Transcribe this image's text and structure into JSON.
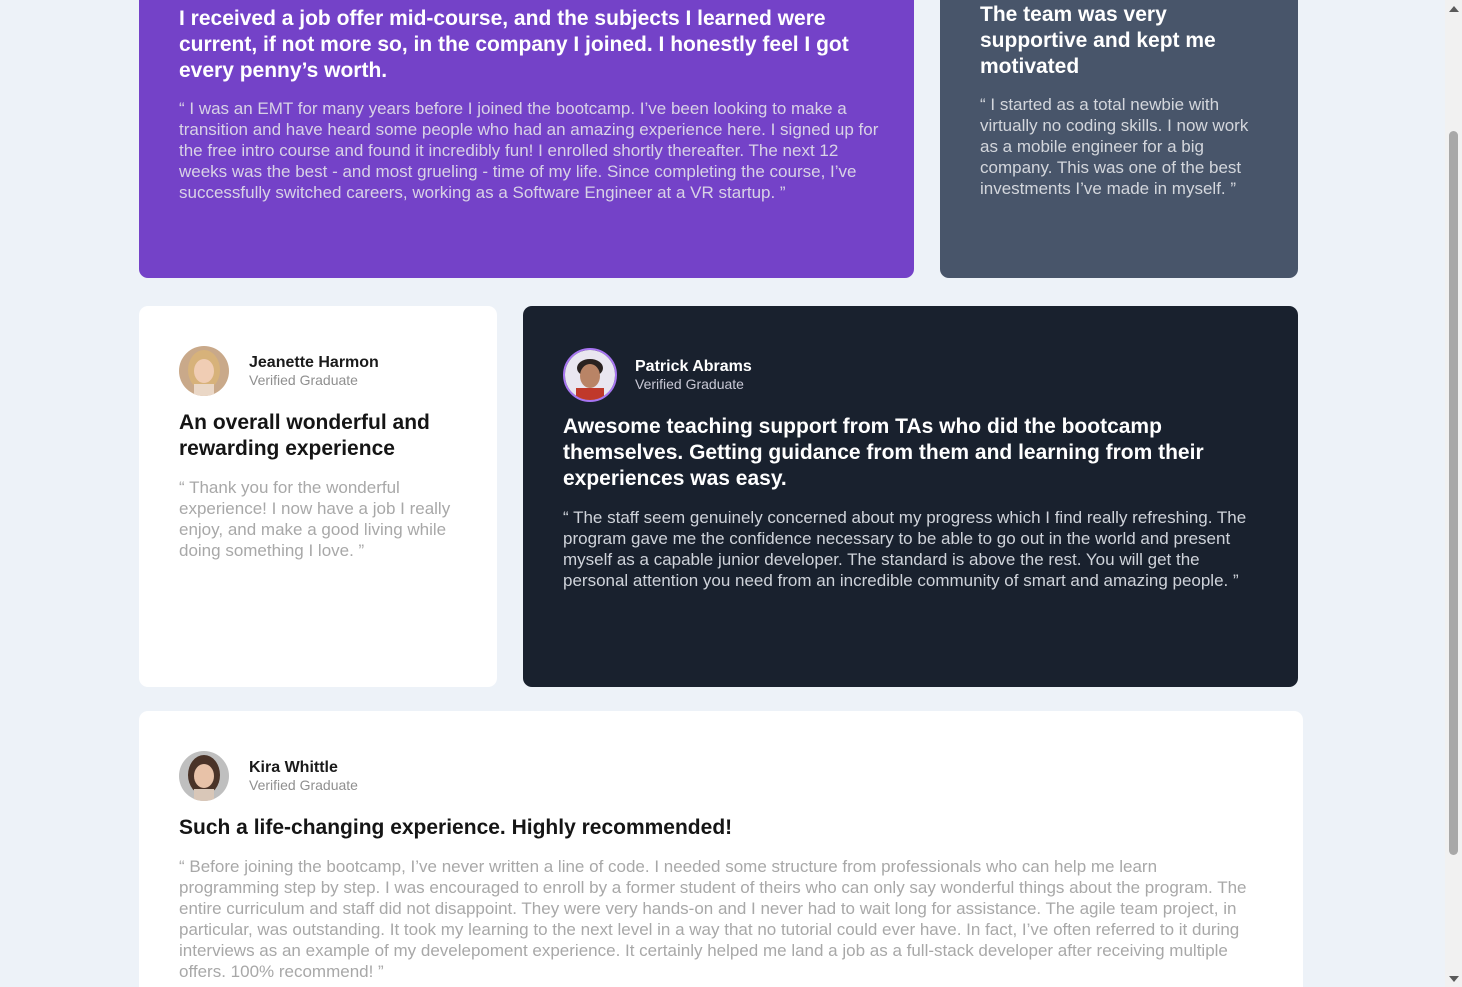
{
  "colors": {
    "page_background": "#edf2f8",
    "violet": "#7442c8",
    "grayish_blue": "#48556a",
    "very_dark_blue": "#19212e",
    "white": "#ffffff"
  },
  "testimonials": {
    "daniel": {
      "headline": "I received a job offer mid-course, and the subjects I learned were current, if not more so, in the company I joined. I honestly feel I got every penny’s worth.",
      "body": "“ I was an EMT for many years before I joined the bootcamp. I’ve been looking to make a transition and have heard some people who had an amazing experience here. I signed up for the free intro course and found it incredibly fun! I enrolled shortly thereafter. The next 12 weeks was the best - and most grueling - time of my life. Since completing the course, I’ve successfully switched careers, working as a Software Engineer at a VR startup. ”"
    },
    "jonathan": {
      "headline": "The team was very supportive and kept me motivated",
      "body": "“ I started as a total newbie with virtually no coding skills. I now work as a mobile engineer for a big company. This was one of the best investments I’ve made in myself. ”"
    },
    "jeanette": {
      "name": "Jeanette Harmon",
      "role": "Verified Graduate",
      "avatar_icon": "woman-portrait-avatar",
      "headline": "An overall wonderful and rewarding experience",
      "body": "“ Thank you for the wonderful experience! I now have a job I really enjoy, and make a good living while doing something I love. ”"
    },
    "patrick": {
      "name": "Patrick Abrams",
      "role": "Verified Graduate",
      "avatar_icon": "man-portrait-avatar",
      "headline": "Awesome teaching support from TAs who did the bootcamp themselves. Getting guidance from them and learning from their experiences was easy.",
      "body": "“ The staff seem genuinely concerned about my progress which I find really refreshing. The program gave me the confidence necessary to be able to go out in the world and present myself as a capable junior developer. The standard is above the rest. You will get the personal attention you need from an incredible community of smart and amazing people. ”"
    },
    "kira": {
      "name": "Kira Whittle",
      "role": "Verified Graduate",
      "avatar_icon": "woman-portrait-avatar",
      "headline": "Such a life-changing experience. Highly recommended!",
      "body": "“ Before joining the bootcamp, I’ve never written a line of code. I needed some structure from professionals who can help me learn programming step by step. I was encouraged to enroll by a former student of theirs who can only say wonderful things about the program. The entire curriculum and staff did not disappoint. They were very hands-on and I never had to wait long for assistance. The agile team project, in particular, was outstanding. It took my learning to the next level in a way that no tutorial could ever have. In fact, I’ve often referred to it during interviews as an example of my develepoment experience. It certainly helped me land a job as a full-stack developer after receiving multiple offers. 100% recommend! ”"
    }
  },
  "scrollbar": {
    "position_fraction": 0.15
  }
}
